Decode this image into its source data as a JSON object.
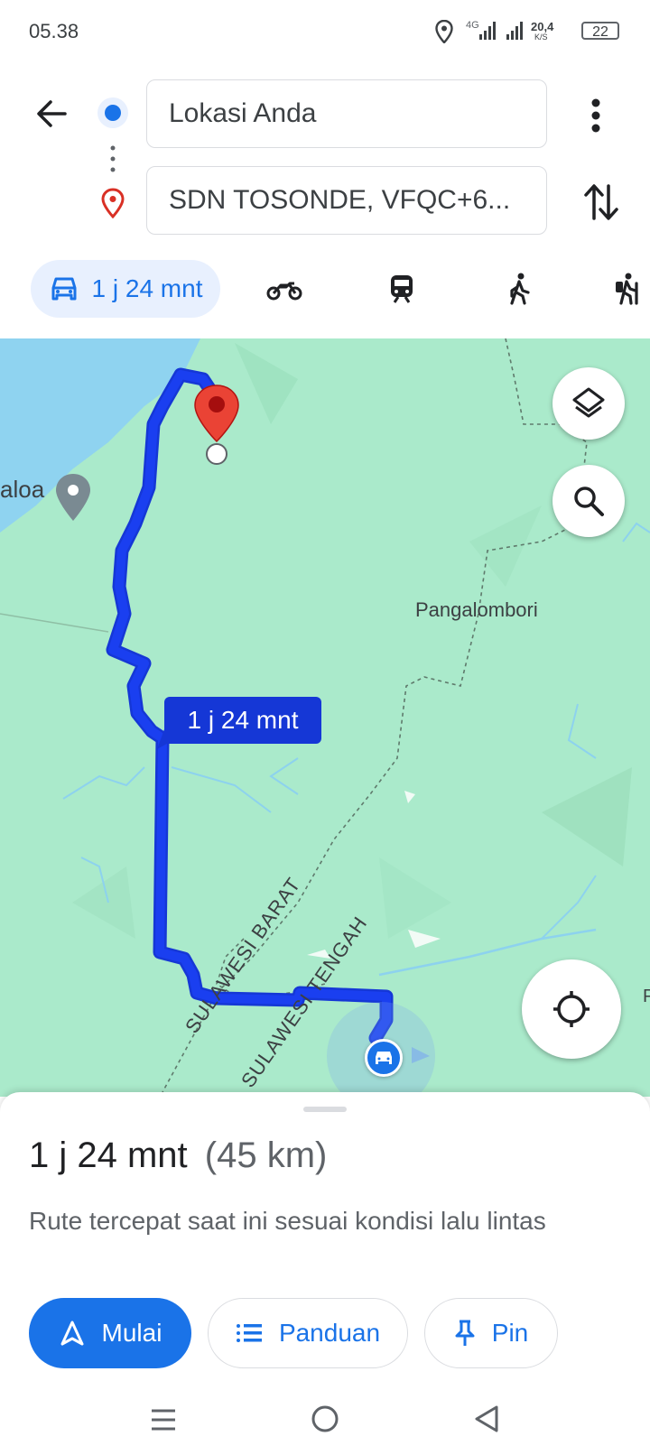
{
  "status_bar": {
    "time": "05.38",
    "network": "4G",
    "speed_value": "20,4",
    "speed_unit": "K/S",
    "battery": "22"
  },
  "header": {
    "origin": "Lokasi Anda",
    "destination": "SDN TOSONDE, VFQC+6...",
    "modes": [
      {
        "icon": "car-icon",
        "label": "1 j 24 mnt",
        "selected": true
      },
      {
        "icon": "motorcycle-icon",
        "label": ""
      },
      {
        "icon": "train-icon",
        "label": ""
      },
      {
        "icon": "walking-icon",
        "label": ""
      },
      {
        "icon": "hiking-icon",
        "label": ""
      }
    ]
  },
  "map": {
    "route_callout": "1 j 24 mnt",
    "place_labels": [
      "aloa",
      "Pangalombori",
      "SULAWESI BARAT",
      "SULAWESI TENGAH",
      "P"
    ],
    "route_color": "#1a3ff0",
    "land_color": "#aaeacb",
    "water_color": "#8fd3f0"
  },
  "sheet": {
    "duration": "1 j 24 mnt",
    "distance": "(45 km)",
    "description": "Rute tercepat saat ini sesuai kondisi lalu lintas",
    "buttons": {
      "start": "Mulai",
      "guide": "Panduan",
      "pin": "Pin"
    }
  },
  "accent": "#1a73e8"
}
